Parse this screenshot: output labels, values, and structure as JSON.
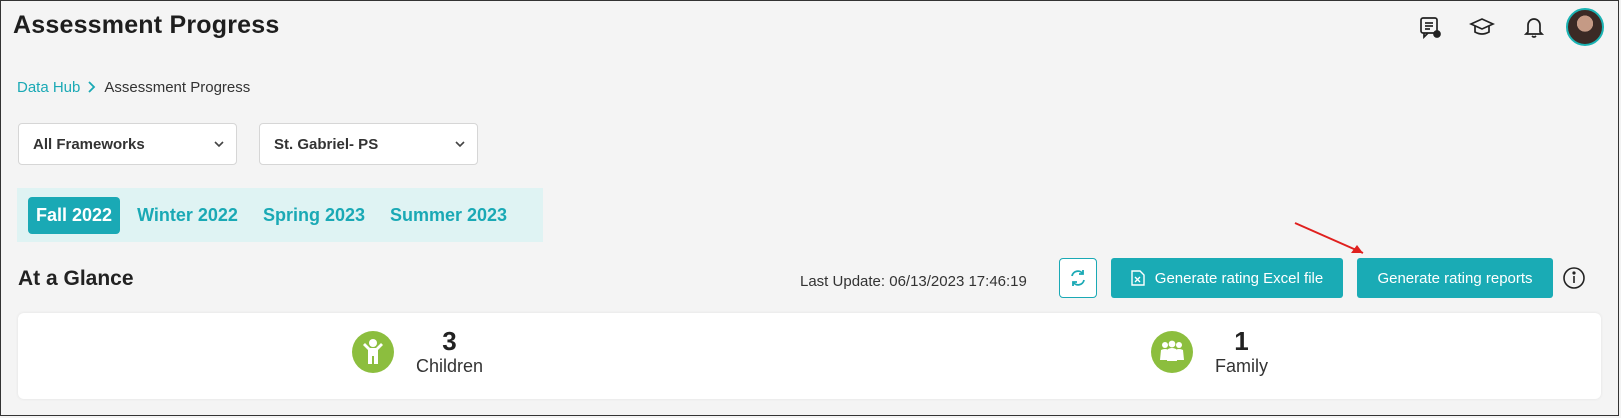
{
  "page": {
    "title": "Assessment Progress"
  },
  "header_icons": [
    "report-icon",
    "graduation-cap-icon",
    "bell-icon",
    "user-avatar"
  ],
  "breadcrumb": {
    "root": "Data Hub",
    "separator": ">",
    "current": "Assessment Progress"
  },
  "filters": {
    "framework": "All Frameworks",
    "site": "St. Gabriel- PS"
  },
  "seasons": [
    {
      "label": "Fall 2022",
      "active": true
    },
    {
      "label": "Winter 2022",
      "active": false
    },
    {
      "label": "Spring 2023",
      "active": false
    },
    {
      "label": "Summer 2023",
      "active": false
    }
  ],
  "glance": {
    "title": "At a Glance",
    "last_update": "Last Update: 06/13/2023 17:46:19",
    "excel_button": "Generate rating Excel file",
    "reports_button": "Generate rating reports",
    "stats": [
      {
        "value": "3",
        "label": "Children",
        "icon": "child-icon"
      },
      {
        "value": "1",
        "label": "Family",
        "icon": "family-icon"
      }
    ]
  },
  "colors": {
    "accent": "#1aabb5",
    "stat_green": "#8cbe3e",
    "annotation_red": "#e0201e"
  }
}
